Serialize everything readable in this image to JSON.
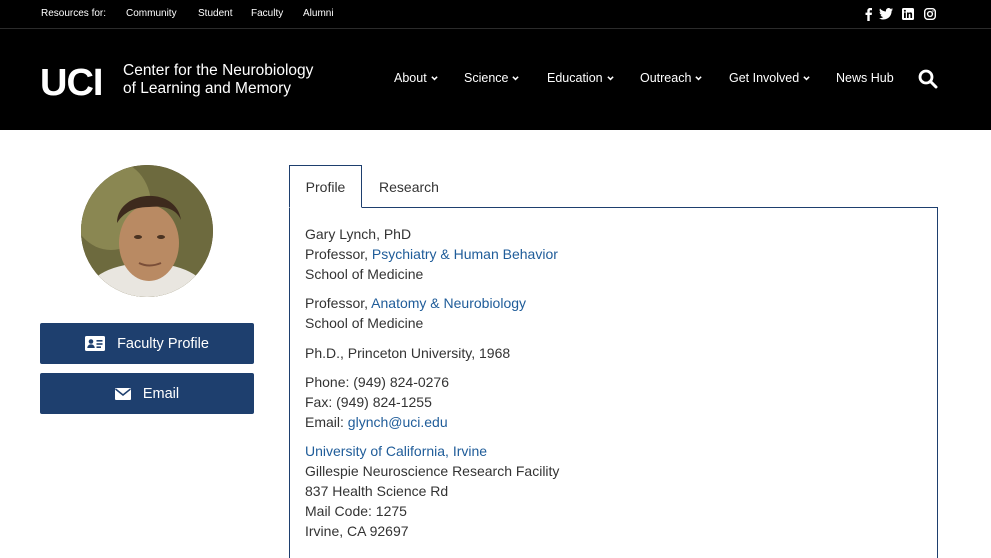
{
  "utility_bar": {
    "resources_label": "Resources for:",
    "links": [
      "Community",
      "Student",
      "Faculty",
      "Alumni"
    ],
    "social_icons": [
      "facebook-icon",
      "twitter-icon",
      "linkedin-icon",
      "instagram-icon"
    ]
  },
  "header": {
    "logo_mark": "UCI",
    "logo_line1": "Center for the Neurobiology",
    "logo_line2": "of Learning and Memory",
    "nav": [
      "About",
      "Science",
      "Education",
      "Outreach",
      "Get Involved",
      "News Hub"
    ],
    "search_icon": "search-icon"
  },
  "sidebar": {
    "faculty_profile_label": "Faculty Profile",
    "email_label": "Email"
  },
  "tabs": [
    "Profile",
    "Research"
  ],
  "profile": {
    "name": "Gary Lynch, PhD",
    "title1_prefix": "Professor, ",
    "title1_dept": "Psychiatry & Human Behavior",
    "school1": "School of Medicine",
    "title2_prefix": "Professor, ",
    "title2_dept": "Anatomy & Neurobiology",
    "school2": "School of Medicine",
    "degree": "Ph.D., Princeton University, 1968",
    "phone": "Phone: (949) 824-0276",
    "fax": "Fax: (949) 824-1255",
    "email_prefix": "Email: ",
    "email": "glynch@uci.edu",
    "university": "University of California, Irvine",
    "facility": "Gillespie Neuroscience Research Facility",
    "street": "837 Health Science Rd",
    "mail_code": "Mail Code: 1275",
    "city": "Irvine, CA 92697"
  },
  "colors": {
    "header_bg": "#000000",
    "button_bg": "#1e3f6e",
    "link": "#1f5c99"
  }
}
